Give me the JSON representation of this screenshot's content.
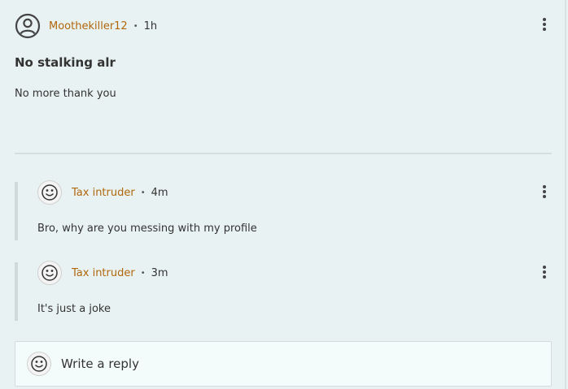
{
  "post": {
    "author": "Moothekiller12",
    "separator": "•",
    "time": "1h",
    "title": "No stalking alr",
    "body": "No more thank you"
  },
  "comments": [
    {
      "author": "Tax intruder",
      "separator": "•",
      "time": "4m",
      "text": "Bro, why are you messing with my profile"
    },
    {
      "author": "Tax intruder",
      "separator": "•",
      "time": "3m",
      "text": "It's just a joke"
    }
  ],
  "reply": {
    "placeholder": "Write a reply"
  },
  "icons": {
    "post_avatar": "user-circle-icon",
    "comment_avatar": "smiley-face-icon",
    "menu": "kebab-menu-icon"
  },
  "colors": {
    "author": "#b0670c",
    "background": "#e9f2f2"
  }
}
